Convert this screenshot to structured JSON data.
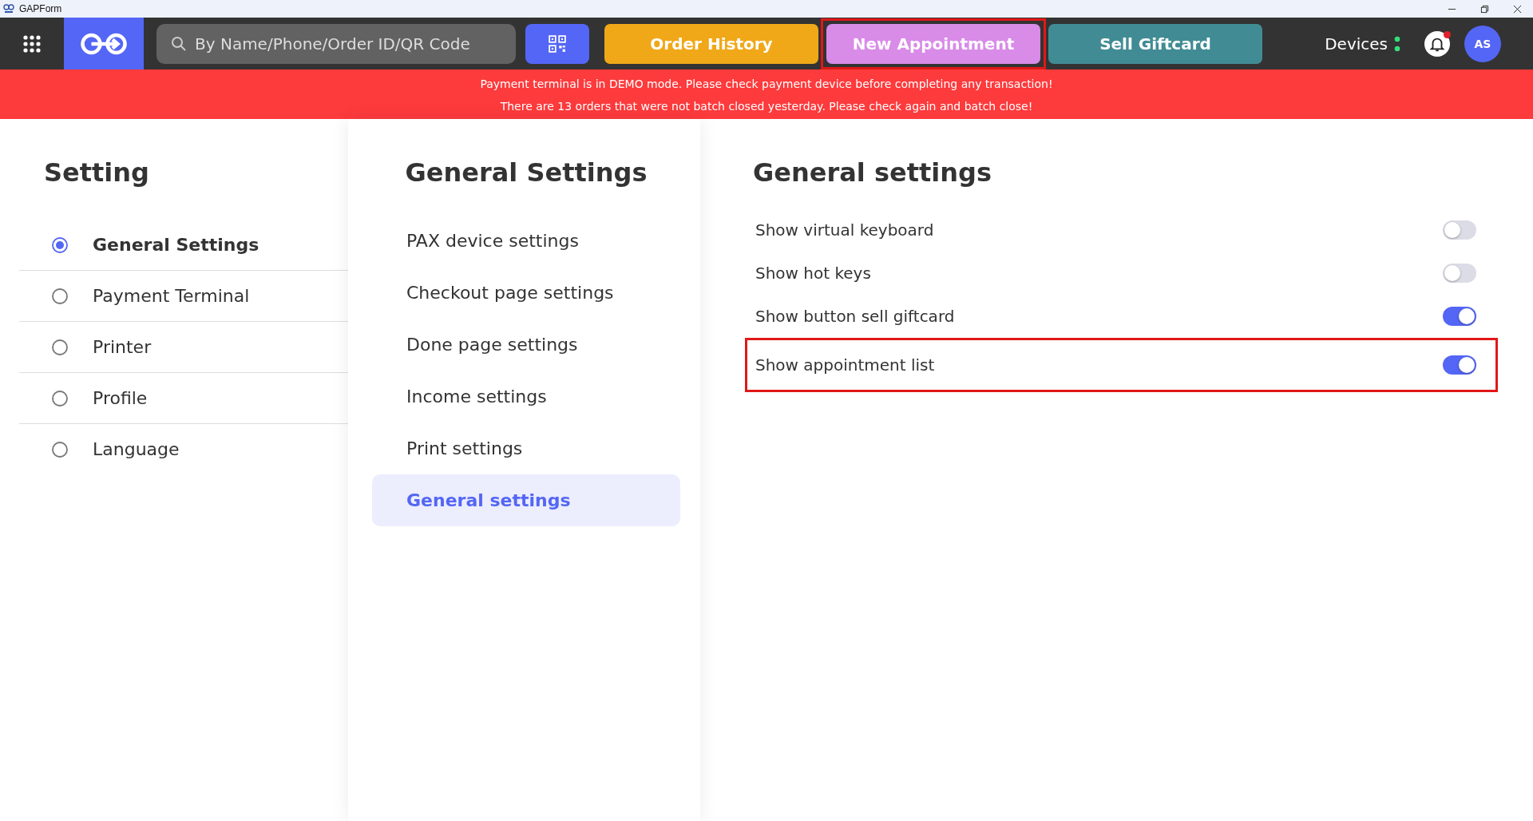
{
  "window": {
    "title": "GAPForm"
  },
  "topbar": {
    "search": {
      "placeholder": "By Name/Phone/Order ID/QR Code"
    },
    "buttons": [
      {
        "kind": "orange",
        "label": "Order History",
        "highlighted": false
      },
      {
        "kind": "violet",
        "label": "New Appointment",
        "highlighted": true
      },
      {
        "kind": "teal",
        "label": "Sell Giftcard",
        "highlighted": false
      }
    ],
    "devices": {
      "label": "Devices"
    },
    "notifications": {
      "unread": true
    },
    "avatar": {
      "initials": "AS"
    }
  },
  "alerts": [
    "Payment terminal is in DEMO mode. Please check payment device before completing any transaction!",
    "There are 13 orders that were not batch closed yesterday. Please check again and batch close!"
  ],
  "sidebar": {
    "title": "Setting",
    "items": [
      {
        "label": "General Settings",
        "selected": true
      },
      {
        "label": "Payment Terminal",
        "selected": false
      },
      {
        "label": "Printer",
        "selected": false
      },
      {
        "label": "Profile",
        "selected": false
      },
      {
        "label": "Language",
        "selected": false
      }
    ]
  },
  "submenu": {
    "title": "General Settings",
    "items": [
      {
        "label": "PAX device settings",
        "selected": false
      },
      {
        "label": "Checkout page settings",
        "selected": false
      },
      {
        "label": "Done page settings",
        "selected": false
      },
      {
        "label": "Income settings",
        "selected": false
      },
      {
        "label": "Print settings",
        "selected": false
      },
      {
        "label": "General settings",
        "selected": true
      }
    ]
  },
  "panel": {
    "title": "General settings",
    "settings": [
      {
        "label": "Show virtual keyboard",
        "on": false,
        "highlighted": false
      },
      {
        "label": "Show hot keys",
        "on": false,
        "highlighted": false
      },
      {
        "label": "Show button sell giftcard",
        "on": true,
        "highlighted": false
      },
      {
        "label": "Show appointment list",
        "on": true,
        "highlighted": true
      }
    ]
  }
}
